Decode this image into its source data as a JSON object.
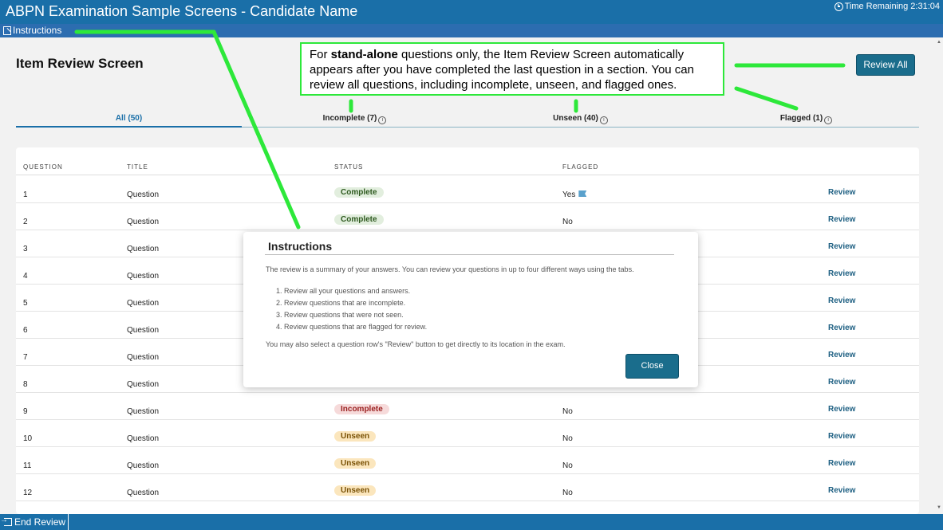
{
  "app": {
    "title": "ABPN Examination Sample Screens - Candidate Name",
    "timer": "Time Remaining 2:31:04"
  },
  "menubar": {
    "instructions_label": "Instructions"
  },
  "page": {
    "heading": "Item Review Screen",
    "review_all_label": "Review All"
  },
  "tabs": [
    {
      "label": "All (50)",
      "active": true,
      "info": false
    },
    {
      "label": "Incomplete (7)",
      "active": false,
      "info": true
    },
    {
      "label": "Unseen (40)",
      "active": false,
      "info": true
    },
    {
      "label": "Flagged (1)",
      "active": false,
      "info": true
    }
  ],
  "table": {
    "headers": {
      "question": "QUESTION",
      "title": "TITLE",
      "status": "STATUS",
      "flagged": "FLAGGED"
    },
    "review_label": "Review",
    "rows": [
      {
        "question": "1",
        "title": "Question",
        "status": "Complete",
        "flagged": "Yes",
        "flag_icon": true
      },
      {
        "question": "2",
        "title": "Question",
        "status": "Complete",
        "flagged": "No"
      },
      {
        "question": "3",
        "title": "Question",
        "status": "",
        "flagged": ""
      },
      {
        "question": "4",
        "title": "Question",
        "status": "",
        "flagged": ""
      },
      {
        "question": "5",
        "title": "Question",
        "status": "",
        "flagged": ""
      },
      {
        "question": "6",
        "title": "Question",
        "status": "",
        "flagged": ""
      },
      {
        "question": "7",
        "title": "Question",
        "status": "",
        "flagged": ""
      },
      {
        "question": "8",
        "title": "Question",
        "status": "",
        "flagged": ""
      },
      {
        "question": "9",
        "title": "Question",
        "status": "Incomplete",
        "flagged": "No"
      },
      {
        "question": "10",
        "title": "Question",
        "status": "Unseen",
        "flagged": "No"
      },
      {
        "question": "11",
        "title": "Question",
        "status": "Unseen",
        "flagged": "No"
      },
      {
        "question": "12",
        "title": "Question",
        "status": "Unseen",
        "flagged": "No"
      }
    ]
  },
  "modal": {
    "title": "Instructions",
    "intro": "The review is a summary of your answers. You can review your questions in up to four different ways using the tabs.",
    "items": [
      "1. Review all your questions and answers.",
      "2. Review questions that are incomplete.",
      "3. Review questions that were not seen.",
      "4. Review questions that are flagged for review."
    ],
    "footer": "You may also select a question row's \"Review\" button to get directly to its location in the exam.",
    "close_label": "Close"
  },
  "callout": {
    "prefix": "For ",
    "bold": "stand-alone",
    "rest": " questions only, the Item Review Screen automatically appears after you have completed the last question in a section. You can review all questions, including incomplete, unseen, and flagged ones."
  },
  "bottombar": {
    "end_review_label": "End Review"
  },
  "colors": {
    "titlebar": "#1a6fa8",
    "accent_button": "#1a6d8c",
    "annotation_green": "#2de83a",
    "status_complete_bg": "#e2eede",
    "status_incomplete_bg": "#f6dada",
    "status_unseen_bg": "#fbe6bd"
  },
  "icons": [
    "clock-icon",
    "instructions-icon",
    "info-icon",
    "flag-icon",
    "exit-icon",
    "scroll-up-icon",
    "scroll-down-icon"
  ]
}
